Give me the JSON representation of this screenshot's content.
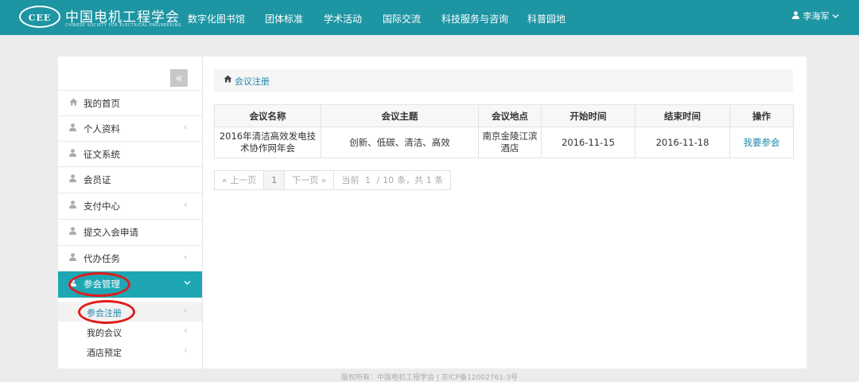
{
  "header": {
    "logo_text": "CEE",
    "brand": "中国电机工程学会",
    "brand_sub": "CHINESE SOCIETY FOR ELECTRICAL ENGINEERING",
    "nav": [
      "数字化图书馆",
      "团体标准",
      "学术活动",
      "国际交流",
      "科技服务与咨询",
      "科普园地"
    ],
    "user_name": "李海军"
  },
  "sidebar": {
    "collapse_icon": "«",
    "items": [
      {
        "label": "我的首页",
        "icon": "home-icon",
        "has_arrow": false
      },
      {
        "label": "个人资料",
        "icon": "user-icon",
        "has_arrow": true
      },
      {
        "label": "征文系统",
        "icon": "user-icon",
        "has_arrow": false
      },
      {
        "label": "会员证",
        "icon": "user-icon",
        "has_arrow": false
      },
      {
        "label": "支付中心",
        "icon": "user-icon",
        "has_arrow": true
      },
      {
        "label": "提交入会申请",
        "icon": "user-icon",
        "has_arrow": false
      },
      {
        "label": "代办任务",
        "icon": "user-icon",
        "has_arrow": true
      },
      {
        "label": "参会管理",
        "icon": "user-icon",
        "has_arrow": true,
        "active": true
      }
    ],
    "subitems": [
      {
        "label": "参会注册",
        "current": true
      },
      {
        "label": "我的会议"
      },
      {
        "label": "酒店预定"
      }
    ]
  },
  "breadcrumb": {
    "text": "会议注册"
  },
  "table": {
    "columns": [
      "会议名称",
      "会议主题",
      "会议地点",
      "开始时间",
      "结束时间",
      "操作"
    ],
    "rows": [
      {
        "name_line1": "2016年清洁高效发电技",
        "name_line2": "术协作网年会",
        "theme": "创新、低碳、清洁、高效",
        "location_line1": "南京金陵江滨",
        "location_line2": "酒店",
        "start": "2016-11-15",
        "end": "2016-11-18",
        "action": "我要参会"
      }
    ]
  },
  "pager": {
    "prev": "« 上一页",
    "page": "1",
    "next": "下一页 »",
    "current_label": "当前",
    "from": "1",
    "sep": "/",
    "to": "10",
    "unit": "条，共",
    "total": "1",
    "total_unit": "条"
  },
  "footer": {
    "text": "版权所有：中国电机工程学会 | 京ICP备12002761-3号"
  },
  "colors": {
    "header": "#1e95a3",
    "active": "#1ea7b3",
    "link": "#1e88a8",
    "highlight": "#e21b1b"
  }
}
